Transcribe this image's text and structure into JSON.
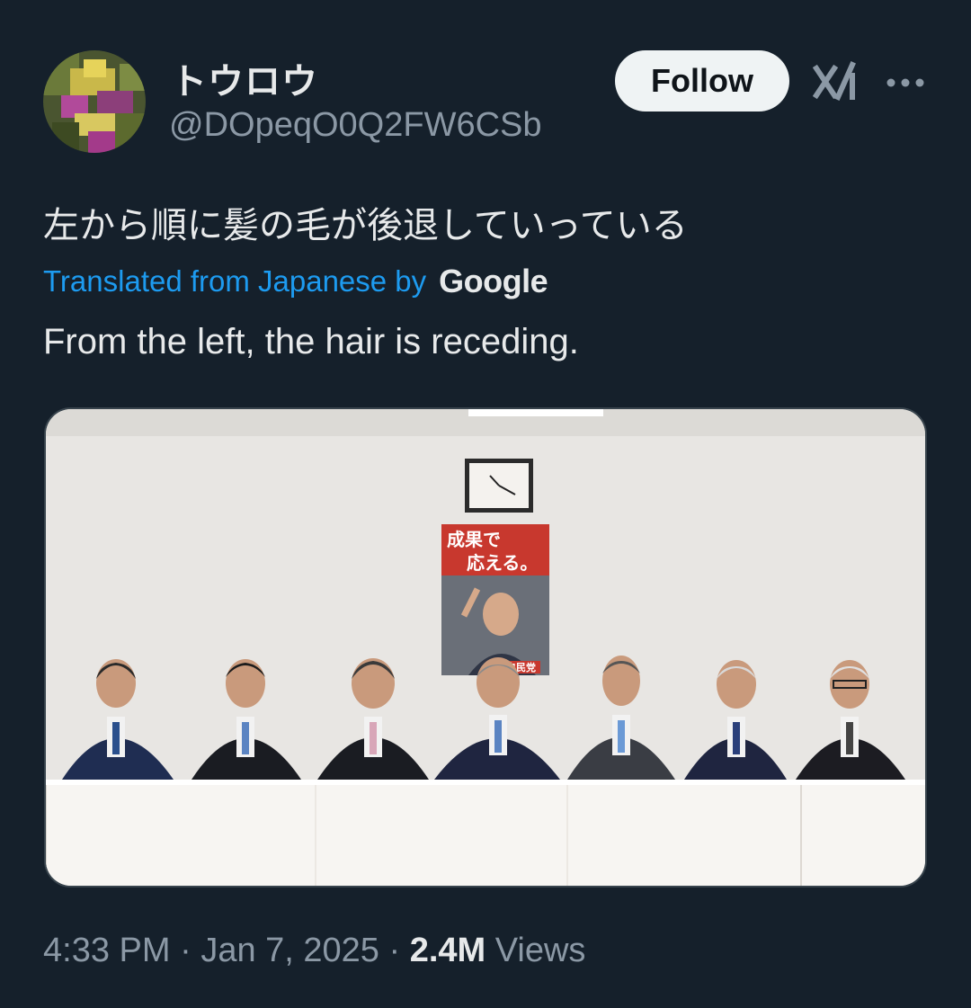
{
  "tweet": {
    "display_name": "トウロウ",
    "handle": "@DOpeqO0Q2FW6CSb",
    "follow_label": "Follow",
    "text_original": "左から順に髪の毛が後退していっている",
    "translated_label": "Translated from Japanese by",
    "translator_brand": "Google",
    "text_translated": "From the left, the hair is receding.",
    "time": "4:33 PM",
    "separator": " · ",
    "date": "Jan 7, 2025",
    "views_count": "2.4M",
    "views_label": " Views"
  },
  "image": {
    "poster_line1": "成果で",
    "poster_line2": "応える。",
    "poster_party": "自民党"
  },
  "colors": {
    "background": "#15202b",
    "text": "#e7e9ea",
    "secondary": "#8b98a5",
    "link": "#1d9bf0",
    "follow_bg": "#eff3f4"
  },
  "icons": [
    "grok-icon",
    "more-icon"
  ]
}
